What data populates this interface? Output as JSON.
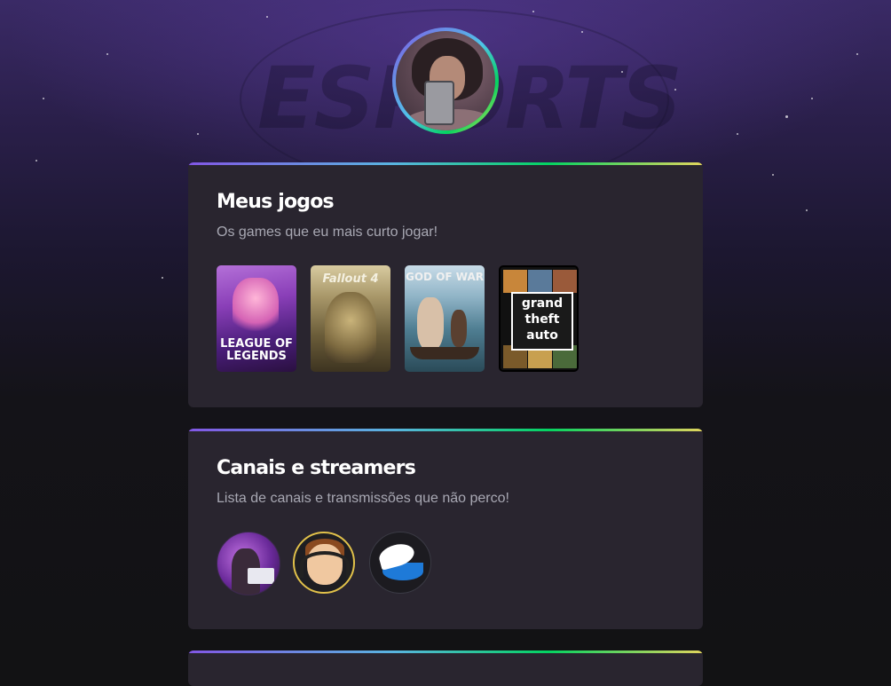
{
  "profile": {
    "avatar_icon": "profile-photo"
  },
  "background": {
    "watermark": "ESPORTS"
  },
  "colors": {
    "card_bg": "#29252f",
    "title": "#ffffff",
    "text": "#a8a8b3",
    "gradient": [
      "#8257e5",
      "#59b5e0",
      "#04d361",
      "#e1d55d"
    ]
  },
  "games_section": {
    "title": "Meus jogos",
    "subtitle": "Os games que eu mais curto jogar!",
    "games": [
      {
        "name": "League of Legends",
        "cover_text": "LEAGUE OF LEGENDS"
      },
      {
        "name": "Fallout 4",
        "cover_text": "Fallout 4"
      },
      {
        "name": "God of War",
        "cover_text": "GOD OF WAR"
      },
      {
        "name": "Grand Theft Auto V",
        "cover_text": [
          "grand",
          "theft",
          "auto"
        ]
      }
    ]
  },
  "streamers_section": {
    "title": "Canais e streamers",
    "subtitle": "Lista de canais e transmissões que não perco!",
    "streamers": [
      {
        "icon": "streamer-avatar-1"
      },
      {
        "icon": "streamer-avatar-2"
      },
      {
        "icon": "streamer-avatar-3"
      }
    ]
  }
}
